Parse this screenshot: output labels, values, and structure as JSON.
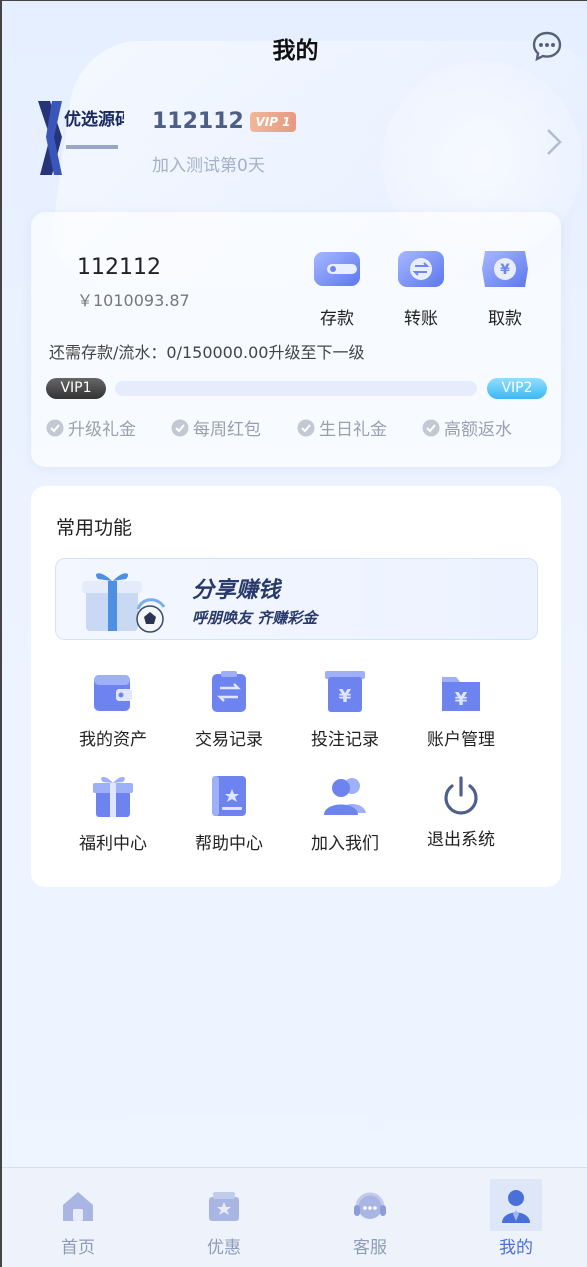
{
  "header": {
    "title": "我的",
    "message_icon": "chat-bubble-icon"
  },
  "profile": {
    "avatar_logo": "优选源码库",
    "username": "112112",
    "vip_badge": "VIP 1",
    "joined_text": "加入测试第0天"
  },
  "wallet": {
    "account_name": "112112",
    "balance": "￥1010093.87",
    "actions": [
      {
        "label": "存款",
        "icon": "wallet-icon"
      },
      {
        "label": "转账",
        "icon": "transfer-icon"
      },
      {
        "label": "取款",
        "icon": "withdraw-yen-icon"
      }
    ],
    "upgrade_text": "还需存款/流水：0/150000.00升级至下一级",
    "current_level": "VIP1",
    "next_level": "VIP2",
    "progress": 0,
    "perks": [
      "升级礼金",
      "每周红包",
      "生日礼金",
      "高额返水"
    ]
  },
  "common": {
    "title": "常用功能",
    "banner_title": "分享赚钱",
    "banner_subtitle": "呼朋唤友 齐赚彩金",
    "items": [
      {
        "label": "我的资产",
        "icon": "wallet-icon"
      },
      {
        "label": "交易记录",
        "icon": "clipboard-transfer-icon"
      },
      {
        "label": "投注记录",
        "icon": "receipt-yen-icon"
      },
      {
        "label": "账户管理",
        "icon": "folder-yen-icon"
      },
      {
        "label": "福利中心",
        "icon": "gift-icon"
      },
      {
        "label": "帮助中心",
        "icon": "book-icon"
      },
      {
        "label": "加入我们",
        "icon": "users-icon"
      },
      {
        "label": "退出系统",
        "icon": "power-icon"
      }
    ]
  },
  "bottom_nav": [
    {
      "label": "首页",
      "icon": "home-icon"
    },
    {
      "label": "优惠",
      "icon": "promo-icon"
    },
    {
      "label": "客服",
      "icon": "headset-icon"
    },
    {
      "label": "我的",
      "icon": "profile-icon",
      "active": true
    }
  ],
  "colors": {
    "accent": "#4a6fd8",
    "icon_blue": "#6f86f2",
    "muted": "#8f9cb6"
  }
}
